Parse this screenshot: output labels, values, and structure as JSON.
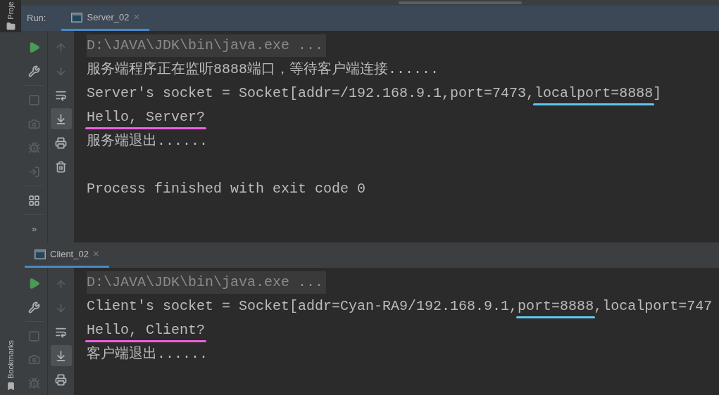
{
  "side_strip": {
    "top_label": "Proje",
    "bottom_label": "Bookmarks"
  },
  "run_label": "Run:",
  "panels": [
    {
      "tab": {
        "label": "Server_02",
        "selected": true,
        "close": "×"
      },
      "left_tools": [
        {
          "kind": "run",
          "disabled": false
        },
        {
          "kind": "settings",
          "disabled": false
        },
        {
          "kind": "separator"
        },
        {
          "kind": "stop",
          "disabled": true
        },
        {
          "kind": "camera",
          "disabled": true
        },
        {
          "kind": "debug",
          "disabled": true
        },
        {
          "kind": "exit",
          "disabled": true
        },
        {
          "kind": "separator"
        },
        {
          "kind": "layout",
          "disabled": false
        },
        {
          "kind": "separator"
        },
        {
          "kind": "more",
          "disabled": false,
          "text": "»"
        }
      ],
      "right_tools": [
        {
          "kind": "up",
          "disabled": true,
          "selected": false
        },
        {
          "kind": "down",
          "disabled": true,
          "selected": false
        },
        {
          "kind": "wrap",
          "disabled": false,
          "selected": false
        },
        {
          "kind": "scroll-end",
          "disabled": false,
          "selected": true
        },
        {
          "kind": "print",
          "disabled": false,
          "selected": false
        },
        {
          "kind": "trash",
          "disabled": false,
          "selected": false
        }
      ],
      "lines": [
        {
          "kind": "command",
          "segments": [
            {
              "text": "D:\\JAVA\\JDK\\bin\\java.exe ..."
            }
          ]
        },
        {
          "kind": "output",
          "segments": [
            {
              "text": "服务端程序正在监听8888端口，等待客户端连接......"
            }
          ]
        },
        {
          "kind": "output",
          "segments": [
            {
              "text": "Server's socket = Socket[addr=/192.168.9.1,port=7473,"
            },
            {
              "text": "localport=8888",
              "color": "#5ec8f2"
            },
            {
              "text": "]"
            }
          ]
        },
        {
          "kind": "output",
          "segments": [
            {
              "text": "Hello, Server?",
              "color": "#f25ee0"
            }
          ]
        },
        {
          "kind": "output",
          "segments": [
            {
              "text": "服务端退出......"
            }
          ]
        },
        {
          "kind": "blank"
        },
        {
          "kind": "output",
          "segments": [
            {
              "text": "Process finished with exit code 0"
            }
          ]
        }
      ]
    },
    {
      "tab": {
        "label": "Client_02",
        "selected": true,
        "close": "×"
      },
      "left_tools": [
        {
          "kind": "run",
          "disabled": false
        },
        {
          "kind": "settings",
          "disabled": false
        },
        {
          "kind": "separator"
        },
        {
          "kind": "stop",
          "disabled": true
        },
        {
          "kind": "camera",
          "disabled": true
        },
        {
          "kind": "debug",
          "disabled": true
        }
      ],
      "right_tools": [
        {
          "kind": "up",
          "disabled": true,
          "selected": false
        },
        {
          "kind": "down",
          "disabled": true,
          "selected": false
        },
        {
          "kind": "wrap",
          "disabled": false,
          "selected": false
        },
        {
          "kind": "scroll-end",
          "disabled": false,
          "selected": true
        },
        {
          "kind": "print",
          "disabled": false,
          "selected": false
        }
      ],
      "lines": [
        {
          "kind": "command",
          "segments": [
            {
              "text": "D:\\JAVA\\JDK\\bin\\java.exe ..."
            }
          ]
        },
        {
          "kind": "output",
          "segments": [
            {
              "text": "Client's socket = Socket[addr=Cyan-RA9/192.168.9.1,"
            },
            {
              "text": "port=8888",
              "color": "#5ec8f2"
            },
            {
              "text": ",localport=747"
            }
          ]
        },
        {
          "kind": "output",
          "segments": [
            {
              "text": "Hello, Client?",
              "color": "#f25ee0"
            }
          ]
        },
        {
          "kind": "output",
          "segments": [
            {
              "text": "客户端退出......"
            }
          ]
        }
      ]
    }
  ]
}
